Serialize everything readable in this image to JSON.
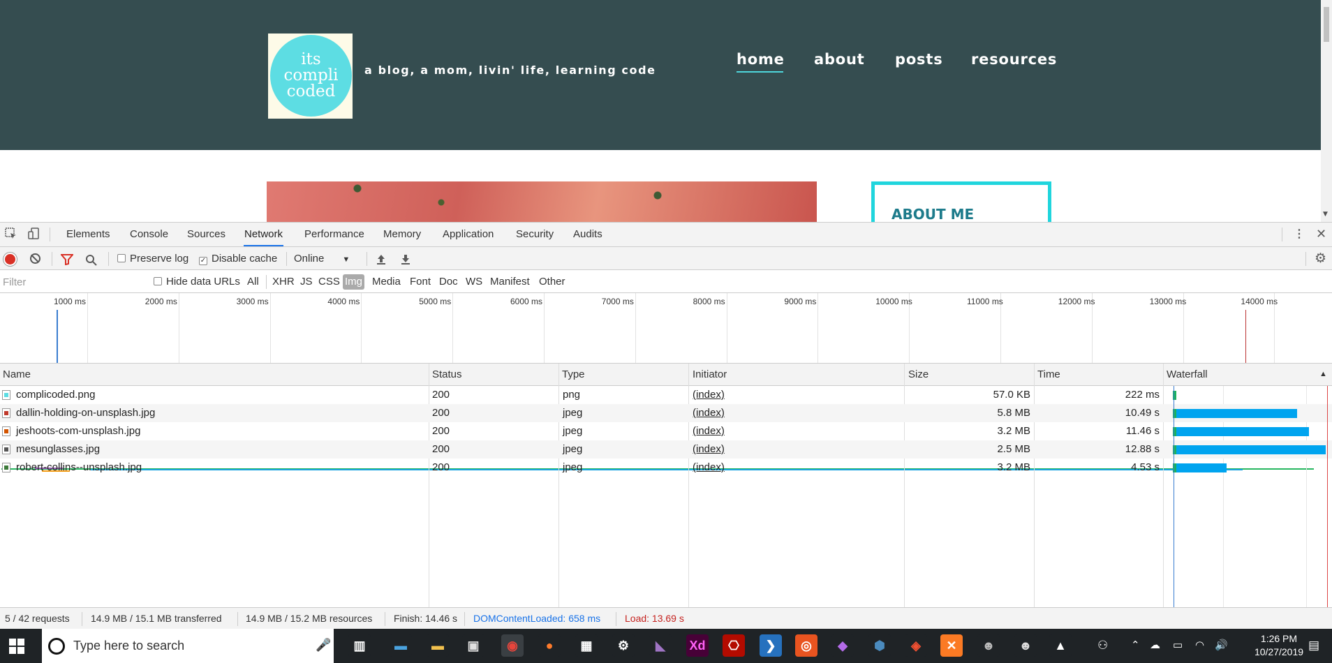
{
  "site": {
    "logo_text": "its\ncompli\ncoded",
    "tagline": "a blog, a mom, livin' life, learning code",
    "nav": {
      "home": "home",
      "about": "about",
      "posts": "posts",
      "resources": "resources"
    },
    "about_title": "ABOUT ME",
    "colors": {
      "header": "#354d50",
      "logo_circle": "#5ddde3",
      "accent": "#20d5dd"
    }
  },
  "devtools": {
    "tabs": [
      "Elements",
      "Console",
      "Sources",
      "Network",
      "Performance",
      "Memory",
      "Application",
      "Security",
      "Audits"
    ],
    "active_tab": "Network",
    "toolbar": {
      "preserve_log": "Preserve log",
      "disable_cache": "Disable cache",
      "disable_cache_checked": true,
      "throttle": "Online"
    },
    "filter": {
      "placeholder": "Filter",
      "hide_data_urls": "Hide data URLs",
      "types": [
        "All",
        "XHR",
        "JS",
        "CSS",
        "Img",
        "Media",
        "Font",
        "Doc",
        "WS",
        "Manifest",
        "Other"
      ],
      "active_type": "Img"
    },
    "overview_ticks": [
      "1000 ms",
      "2000 ms",
      "3000 ms",
      "4000 ms",
      "5000 ms",
      "6000 ms",
      "7000 ms",
      "8000 ms",
      "9000 ms",
      "10000 ms",
      "11000 ms",
      "12000 ms",
      "13000 ms",
      "14000 ms",
      "1"
    ],
    "columns": {
      "name": "Name",
      "status": "Status",
      "type": "Type",
      "initiator": "Initiator",
      "size": "Size",
      "time": "Time",
      "waterfall": "Waterfall"
    },
    "rows": [
      {
        "name": "complicoded.png",
        "status": "200",
        "type": "png",
        "initiator": "(index)",
        "size": "57.0 KB",
        "time": "222 ms",
        "icon_color": "#5ddde3",
        "time_s": 0.222
      },
      {
        "name": "dallin-holding-on-unsplash.jpg",
        "status": "200",
        "type": "jpeg",
        "initiator": "(index)",
        "size": "5.8 MB",
        "time": "10.49 s",
        "icon_color": "#c0392b",
        "time_s": 10.49
      },
      {
        "name": "jeshoots-com-unsplash.jpg",
        "status": "200",
        "type": "jpeg",
        "initiator": "(index)",
        "size": "3.2 MB",
        "time": "11.46 s",
        "icon_color": "#d35400",
        "time_s": 11.46
      },
      {
        "name": "mesunglasses.jpg",
        "status": "200",
        "type": "jpeg",
        "initiator": "(index)",
        "size": "2.5 MB",
        "time": "12.88 s",
        "icon_color": "#555555",
        "time_s": 12.88
      },
      {
        "name": "robert-collins--unsplash.jpg",
        "status": "200",
        "type": "jpeg",
        "initiator": "(index)",
        "size": "3.2 MB",
        "time": "4.53 s",
        "icon_color": "#3d7a3a",
        "time_s": 4.53
      }
    ],
    "summary": {
      "requests": "5 / 42 requests",
      "transferred": "14.9 MB / 15.1 MB transferred",
      "resources": "14.9 MB / 15.2 MB resources",
      "finish": "Finish: 14.46 s",
      "dcl": "DOMContentLoaded: 658 ms",
      "load": "Load: 13.69 s"
    },
    "colors": {
      "waterfall_bar": "#00a4ef",
      "waiting": "#1bb35b",
      "dcl": "#1a73e8",
      "load": "#c5221f"
    }
  },
  "taskbar": {
    "search_placeholder": "Type here to search",
    "apps": [
      "task-view",
      "file-explorer",
      "store",
      "chrome",
      "firefox",
      "calculator",
      "settings",
      "visual-studio",
      "adobe-xd",
      "acrobat",
      "powershell",
      "ubuntu",
      "maps",
      "python",
      "git",
      "xampp",
      "gimp",
      "gimp-2",
      "photos"
    ],
    "time": "1:26 PM",
    "date": "10/27/2019"
  }
}
